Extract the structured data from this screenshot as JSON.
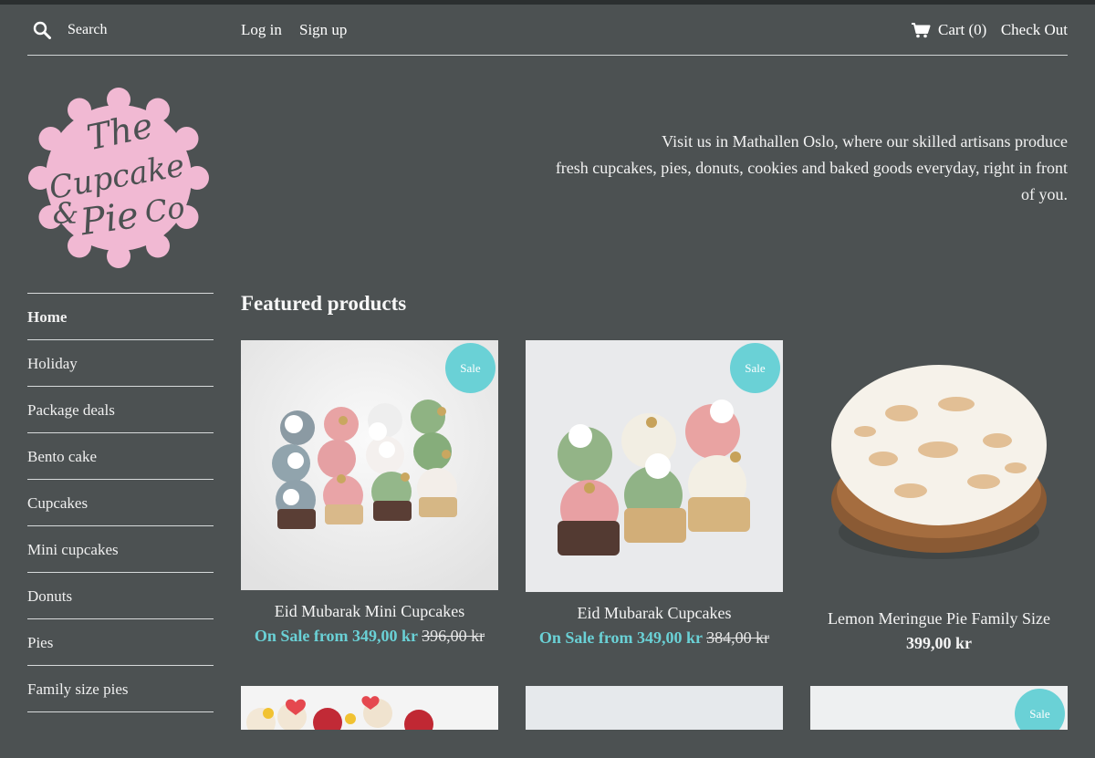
{
  "header": {
    "search_placeholder": "Search",
    "login": "Log in",
    "signup": "Sign up",
    "cart": "Cart (0)",
    "checkout": "Check Out"
  },
  "logo_text": [
    "The",
    "Cupcake",
    "&",
    "Pie",
    "Co"
  ],
  "tagline_lines": [
    "Visit us in Mathallen Oslo, where our skilled artisans produce",
    "fresh cupcakes, pies, donuts, cookies and baked goods everyday, right in front",
    "of you."
  ],
  "nav": {
    "items": [
      {
        "label": "Home"
      },
      {
        "label": "Holiday"
      },
      {
        "label": "Package deals"
      },
      {
        "label": "Bento cake"
      },
      {
        "label": "Cupcakes"
      },
      {
        "label": "Mini cupcakes"
      },
      {
        "label": "Donuts"
      },
      {
        "label": "Pies"
      },
      {
        "label": "Family size pies"
      }
    ]
  },
  "section_title": "Featured products",
  "sale_label": "Sale",
  "products": [
    {
      "name": "Eid Mubarak Mini Cupcakes",
      "sale_text": "On Sale from 349,00 kr",
      "old_price": "396,00 kr"
    },
    {
      "name": "Eid Mubarak Cupcakes",
      "sale_text": "On Sale from 349,00 kr",
      "old_price": "384,00 kr"
    },
    {
      "name": "Lemon Meringue Pie Family Size",
      "price": "399,00 kr"
    }
  ],
  "colors": {
    "background": "#4c5152",
    "accent": "#6ad1d6",
    "logo_pink": "#f1b9d3"
  }
}
